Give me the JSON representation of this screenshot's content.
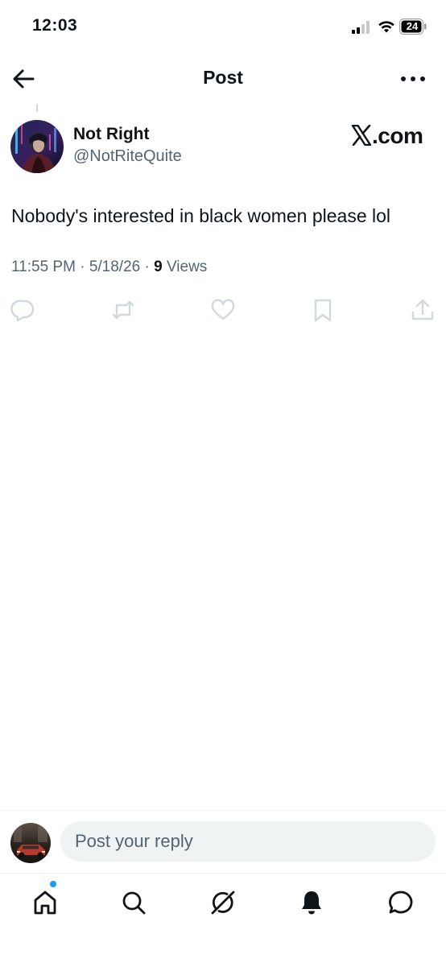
{
  "status_bar": {
    "time": "12:03",
    "battery_level": "24"
  },
  "header": {
    "title": "Post",
    "back_icon": "arrow-left-icon",
    "more_icon": "more-horizontal-icon"
  },
  "post": {
    "author": {
      "display_name": "Not Right",
      "handle": "@NotRiteQuite"
    },
    "source_logo": ".com",
    "text": "Nobody's interested in black women please lol",
    "timestamp": "11:55 PM",
    "separator": "·",
    "date": "5/18/26",
    "views_count": "9",
    "views_label": "Views",
    "actions": [
      "reply-icon",
      "repost-icon",
      "like-icon",
      "bookmark-icon",
      "share-icon"
    ]
  },
  "reply": {
    "placeholder": "Post your reply"
  },
  "tabbar": {
    "tabs": [
      "home-icon",
      "search-icon",
      "grok-icon",
      "notifications-icon",
      "messages-icon"
    ],
    "home_has_notification": true
  },
  "colors": {
    "text": "#0f1419",
    "secondary": "#536471",
    "accent": "#1d9bf0",
    "muted_icon": "#cfd9de"
  }
}
